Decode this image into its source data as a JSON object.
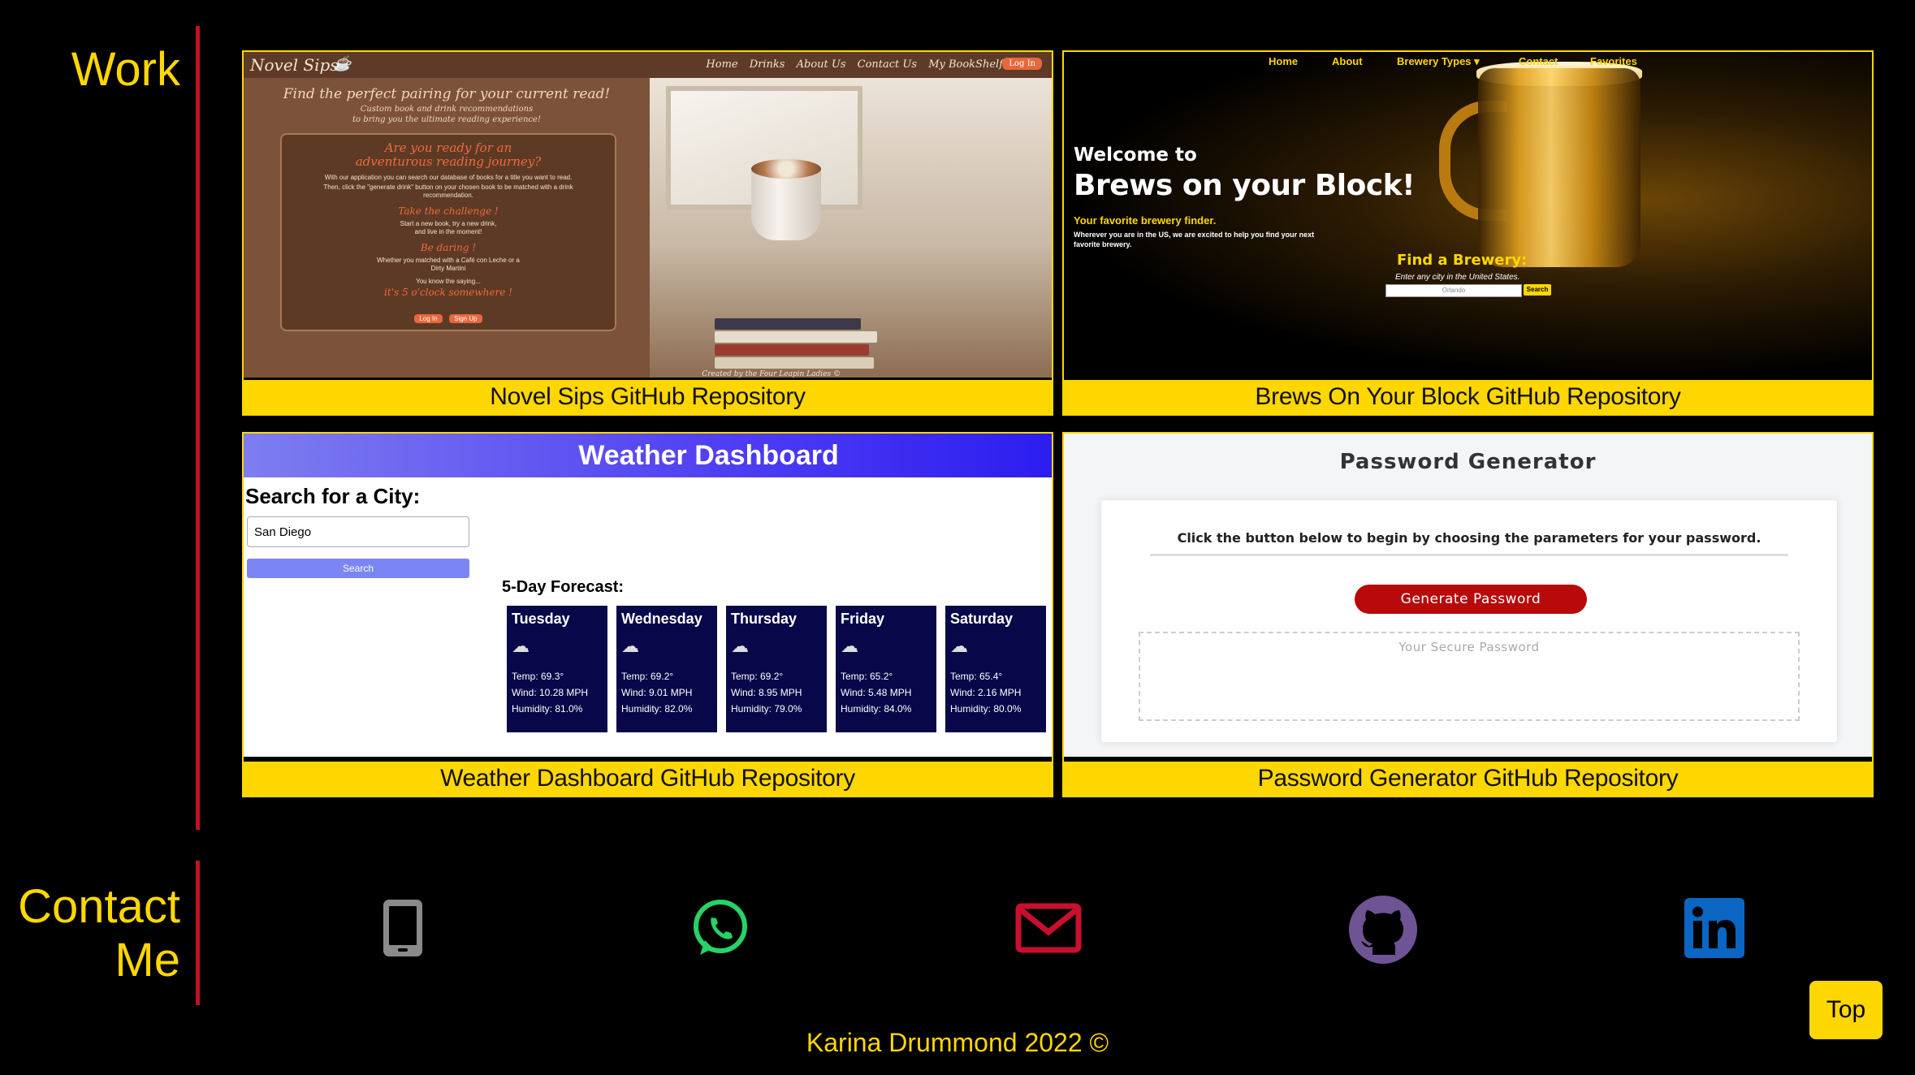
{
  "sections": {
    "work_title": "Work",
    "contact_title_line1": "Contact",
    "contact_title_line2": "Me"
  },
  "projects": [
    {
      "caption": "Novel Sips GitHub Repository",
      "screen": {
        "brand": "Novel Sips",
        "nav": [
          "Home",
          "Drinks",
          "About Us",
          "Contact Us",
          "My BookShelf"
        ],
        "login": "Log In",
        "tagline": "Find the perfect pairing for your current read!",
        "subtagline1": "Custom book and drink recommendations",
        "subtagline2": "to bring you the ultimate reading experience!",
        "box_heading1": "Are you ready for an",
        "box_heading2": "adventurous reading journey?",
        "box_p1": "With our application you can search our database of books for a title you want to read.",
        "box_p2": "Then, click the \"generate drink\" button on your chosen book to be matched with a drink recommendation.",
        "box_heading3": "Take the challenge !",
        "box_p3": "Start a new book, try a new drink, and live in the moment!",
        "box_heading4": "Be daring !",
        "box_p4": "Whether you matched with a Café con Leche or a Dirty Martini",
        "box_p5": "You know the saying...",
        "box_heading5": "it's 5 o'clock somewhere !",
        "btn_login": "Log In",
        "btn_signup": "Sign Up",
        "credit": "Created by the Four Leapin Ladies ©"
      }
    },
    {
      "caption": "Brews On Your Block GitHub Repository",
      "screen": {
        "nav": [
          "Home",
          "About",
          "Brewery Types ▾",
          "Contact",
          "Favorites"
        ],
        "welcome": "Welcome to",
        "title": "Brews on your Block!",
        "favorite": "Your favorite brewery finder.",
        "desc": "Wherever you are in the US, we are excited to help you find your next favorite brewery.",
        "find": "Find a Brewery:",
        "hint": "Enter any city in the United States.",
        "input_value": "Orlando",
        "search": "Search"
      }
    },
    {
      "caption": "Weather Dashboard GitHub Repository",
      "screen": {
        "title": "Weather Dashboard",
        "search_label": "Search for a City:",
        "input_value": "San Diego",
        "search_button": "Search",
        "forecast_label": "5-Day Forecast:",
        "days": [
          {
            "day": "Tuesday",
            "temp": "Temp: 69.3°",
            "wind": "Wind: 10.28 MPH",
            "humidity": "Humidity: 81.0%"
          },
          {
            "day": "Wednesday",
            "temp": "Temp: 69.2°",
            "wind": "Wind: 9.01 MPH",
            "humidity": "Humidity: 82.0%"
          },
          {
            "day": "Thursday",
            "temp": "Temp: 69.2°",
            "wind": "Wind: 8.95 MPH",
            "humidity": "Humidity: 79.0%"
          },
          {
            "day": "Friday",
            "temp": "Temp: 65.2°",
            "wind": "Wind: 5.48 MPH",
            "humidity": "Humidity: 84.0%"
          },
          {
            "day": "Saturday",
            "temp": "Temp: 65.4°",
            "wind": "Wind: 2.16 MPH",
            "humidity": "Humidity: 80.0%"
          }
        ]
      }
    },
    {
      "caption": "Password Generator GitHub Repository",
      "screen": {
        "title": "Password Generator",
        "prompt": "Click the button below to begin by choosing the parameters for your password.",
        "button": "Generate Password",
        "placeholder": "Your Secure Password"
      }
    }
  ],
  "contact_icons": [
    "phone-icon",
    "whatsapp-icon",
    "email-icon",
    "github-icon",
    "linkedin-icon"
  ],
  "colors": {
    "accent": "#ffd700",
    "rule": "#c1121f",
    "phone": "#8a8a8a",
    "whatsapp": "#25d366",
    "email": "#c8102e",
    "github": "#6e5494",
    "linkedin": "#0a66c2"
  },
  "top_button": "Top",
  "footer": "Karina Drummond 2022 ©"
}
